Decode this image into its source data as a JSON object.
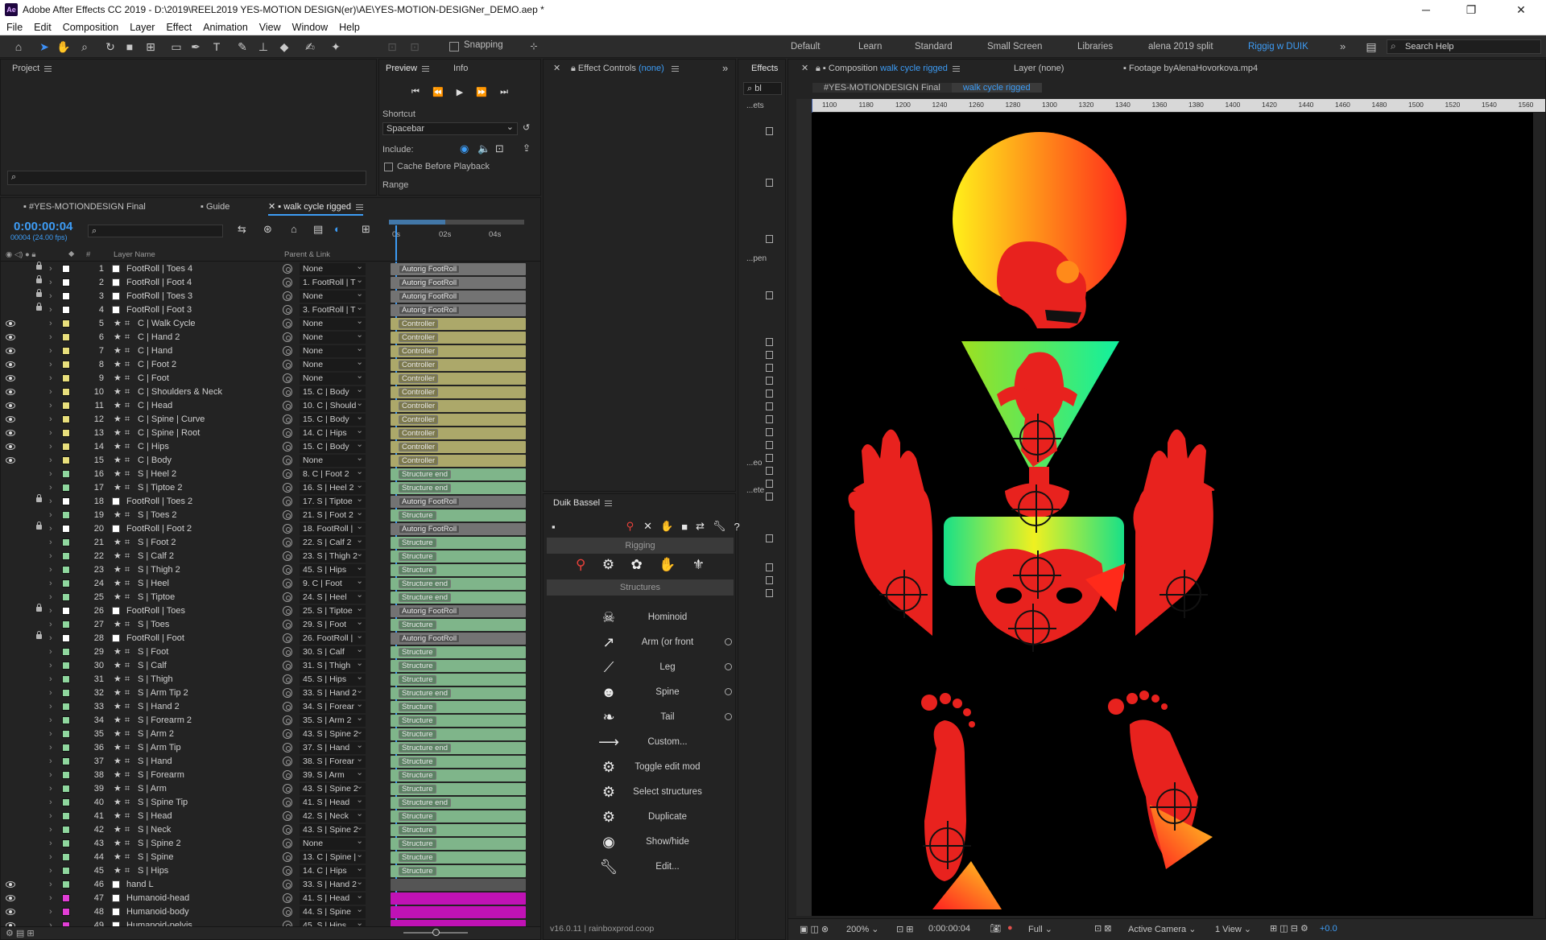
{
  "app": {
    "title": "Adobe After Effects CC 2019 - D:\\2019\\REEL2019 YES-MOTION DESIGN(er)\\AE\\YES-MOTION-DESIGNer_DEMO.aep *",
    "logo": "Ae"
  },
  "menu": [
    "File",
    "Edit",
    "Composition",
    "Layer",
    "Effect",
    "Animation",
    "View",
    "Window",
    "Help"
  ],
  "toolbar": {
    "snapping_label": "Snapping",
    "workspaces": [
      "Default",
      "Learn",
      "Standard",
      "Small Screen",
      "Libraries",
      "alena 2019 split",
      "Riggig w DUIK"
    ],
    "active_workspace": "Riggig w DUIK",
    "search_placeholder": "Search Help"
  },
  "project_panel": {
    "title": "Project"
  },
  "preview_panel": {
    "tabs": [
      "Preview",
      "Info"
    ],
    "shortcut_label": "Shortcut",
    "shortcut_value": "Spacebar",
    "include_label": "Include:",
    "cache_label": "Cache Before Playback",
    "range_label": "Range"
  },
  "effect_controls": {
    "title": "Effect Controls",
    "value": "(none)"
  },
  "effects_panel": {
    "title": "Effects",
    "search_value": "bl",
    "items": [
      "...ets",
      "...pen",
      "...eo",
      "...ete"
    ]
  },
  "timeline": {
    "tabs": [
      "#YES-MOTIONDESIGN Final",
      "Guide",
      "walk cycle rigged"
    ],
    "active_tab": "walk cycle rigged",
    "timecode": "0:00:00:04",
    "frame_info": "00004 (24.00 fps)",
    "col_layer_name": "Layer Name",
    "col_parent": "Parent & Link",
    "ruler": [
      "0s",
      "02s",
      "04s"
    ],
    "layers": [
      {
        "n": "1",
        "name": "FootRoll | Toes 4",
        "parent": "None",
        "bar": "Autorig FootRoll",
        "eye": false,
        "lock": true,
        "color": "#ffffff",
        "star": false
      },
      {
        "n": "2",
        "name": "FootRoll | Foot 4",
        "parent": "1. FootRoll | T",
        "bar": "Autorig FootRoll",
        "eye": false,
        "lock": true,
        "color": "#ffffff",
        "star": false
      },
      {
        "n": "3",
        "name": "FootRoll | Toes 3",
        "parent": "None",
        "bar": "Autorig FootRoll",
        "eye": false,
        "lock": true,
        "color": "#ffffff",
        "star": false
      },
      {
        "n": "4",
        "name": "FootRoll | Foot 3",
        "parent": "3. FootRoll | T",
        "bar": "Autorig FootRoll",
        "eye": false,
        "lock": true,
        "color": "#ffffff",
        "star": false
      },
      {
        "n": "5",
        "name": "C | Walk Cycle",
        "parent": "None",
        "bar": "Controller",
        "eye": true,
        "lock": false,
        "color": "#e8df7c",
        "star": true
      },
      {
        "n": "6",
        "name": "C | Hand 2",
        "parent": "None",
        "bar": "Controller",
        "eye": true,
        "lock": false,
        "color": "#e8df7c",
        "star": true
      },
      {
        "n": "7",
        "name": "C | Hand",
        "parent": "None",
        "bar": "Controller",
        "eye": true,
        "lock": false,
        "color": "#e8df7c",
        "star": true
      },
      {
        "n": "8",
        "name": "C | Foot 2",
        "parent": "None",
        "bar": "Controller",
        "eye": true,
        "lock": false,
        "color": "#e8df7c",
        "star": true
      },
      {
        "n": "9",
        "name": "C | Foot",
        "parent": "None",
        "bar": "Controller",
        "eye": true,
        "lock": false,
        "color": "#e8df7c",
        "star": true
      },
      {
        "n": "10",
        "name": "C | Shoulders & Neck",
        "parent": "15. C | Body",
        "bar": "Controller",
        "eye": true,
        "lock": false,
        "color": "#e8df7c",
        "star": true
      },
      {
        "n": "11",
        "name": "C | Head",
        "parent": "10. C | Should",
        "bar": "Controller",
        "eye": true,
        "lock": false,
        "color": "#e8df7c",
        "star": true
      },
      {
        "n": "12",
        "name": "C | Spine | Curve",
        "parent": "15. C | Body",
        "bar": "Controller",
        "eye": true,
        "lock": false,
        "color": "#e8df7c",
        "star": true
      },
      {
        "n": "13",
        "name": "C | Spine | Root",
        "parent": "14. C | Hips",
        "bar": "Controller",
        "eye": true,
        "lock": false,
        "color": "#e8df7c",
        "star": true
      },
      {
        "n": "14",
        "name": "C | Hips",
        "parent": "15. C | Body",
        "bar": "Controller",
        "eye": true,
        "lock": false,
        "color": "#e8df7c",
        "star": true
      },
      {
        "n": "15",
        "name": "C | Body",
        "parent": "None",
        "bar": "Controller",
        "eye": true,
        "lock": false,
        "color": "#e8df7c",
        "star": true
      },
      {
        "n": "16",
        "name": "S | Heel 2",
        "parent": "8. C | Foot 2",
        "bar": "Structure end",
        "eye": false,
        "lock": false,
        "color": "#8fd79e",
        "star": true
      },
      {
        "n": "17",
        "name": "S | Tiptoe 2",
        "parent": "16. S | Heel 2",
        "bar": "Structure end",
        "eye": false,
        "lock": false,
        "color": "#8fd79e",
        "star": true
      },
      {
        "n": "18",
        "name": "FootRoll | Toes 2",
        "parent": "17. S | Tiptoe",
        "bar": "Autorig FootRoll",
        "eye": false,
        "lock": true,
        "color": "#ffffff",
        "star": false
      },
      {
        "n": "19",
        "name": "S | Toes 2",
        "parent": "21. S | Foot 2",
        "bar": "Structure",
        "eye": false,
        "lock": false,
        "color": "#8fd79e",
        "star": true
      },
      {
        "n": "20",
        "name": "FootRoll | Foot 2",
        "parent": "18. FootRoll |",
        "bar": "Autorig FootRoll",
        "eye": false,
        "lock": true,
        "color": "#ffffff",
        "star": false
      },
      {
        "n": "21",
        "name": "S | Foot 2",
        "parent": "22. S | Calf 2",
        "bar": "Structure",
        "eye": false,
        "lock": false,
        "color": "#8fd79e",
        "star": true
      },
      {
        "n": "22",
        "name": "S | Calf 2",
        "parent": "23. S | Thigh 2",
        "bar": "Structure",
        "eye": false,
        "lock": false,
        "color": "#8fd79e",
        "star": true
      },
      {
        "n": "23",
        "name": "S | Thigh 2",
        "parent": "45. S | Hips",
        "bar": "Structure",
        "eye": false,
        "lock": false,
        "color": "#8fd79e",
        "star": true
      },
      {
        "n": "24",
        "name": "S | Heel",
        "parent": "9. C | Foot",
        "bar": "Structure end",
        "eye": false,
        "lock": false,
        "color": "#8fd79e",
        "star": true
      },
      {
        "n": "25",
        "name": "S | Tiptoe",
        "parent": "24. S | Heel",
        "bar": "Structure end",
        "eye": false,
        "lock": false,
        "color": "#8fd79e",
        "star": true
      },
      {
        "n": "26",
        "name": "FootRoll | Toes",
        "parent": "25. S | Tiptoe",
        "bar": "Autorig FootRoll",
        "eye": false,
        "lock": true,
        "color": "#ffffff",
        "star": false
      },
      {
        "n": "27",
        "name": "S | Toes",
        "parent": "29. S | Foot",
        "bar": "Structure",
        "eye": false,
        "lock": false,
        "color": "#8fd79e",
        "star": true
      },
      {
        "n": "28",
        "name": "FootRoll | Foot",
        "parent": "26. FootRoll |",
        "bar": "Autorig FootRoll",
        "eye": false,
        "lock": true,
        "color": "#ffffff",
        "star": false
      },
      {
        "n": "29",
        "name": "S | Foot",
        "parent": "30. S | Calf",
        "bar": "Structure",
        "eye": false,
        "lock": false,
        "color": "#8fd79e",
        "star": true
      },
      {
        "n": "30",
        "name": "S | Calf",
        "parent": "31. S | Thigh",
        "bar": "Structure",
        "eye": false,
        "lock": false,
        "color": "#8fd79e",
        "star": true
      },
      {
        "n": "31",
        "name": "S | Thigh",
        "parent": "45. S | Hips",
        "bar": "Structure",
        "eye": false,
        "lock": false,
        "color": "#8fd79e",
        "star": true
      },
      {
        "n": "32",
        "name": "S | Arm Tip 2",
        "parent": "33. S | Hand 2",
        "bar": "Structure end",
        "eye": false,
        "lock": false,
        "color": "#8fd79e",
        "star": true
      },
      {
        "n": "33",
        "name": "S | Hand 2",
        "parent": "34. S | Forear",
        "bar": "Structure",
        "eye": false,
        "lock": false,
        "color": "#8fd79e",
        "star": true
      },
      {
        "n": "34",
        "name": "S | Forearm 2",
        "parent": "35. S | Arm 2",
        "bar": "Structure",
        "eye": false,
        "lock": false,
        "color": "#8fd79e",
        "star": true
      },
      {
        "n": "35",
        "name": "S | Arm 2",
        "parent": "43. S | Spine 2",
        "bar": "Structure",
        "eye": false,
        "lock": false,
        "color": "#8fd79e",
        "star": true
      },
      {
        "n": "36",
        "name": "S | Arm Tip",
        "parent": "37. S | Hand",
        "bar": "Structure end",
        "eye": false,
        "lock": false,
        "color": "#8fd79e",
        "star": true
      },
      {
        "n": "37",
        "name": "S | Hand",
        "parent": "38. S | Forear",
        "bar": "Structure",
        "eye": false,
        "lock": false,
        "color": "#8fd79e",
        "star": true
      },
      {
        "n": "38",
        "name": "S | Forearm",
        "parent": "39. S | Arm",
        "bar": "Structure",
        "eye": false,
        "lock": false,
        "color": "#8fd79e",
        "star": true
      },
      {
        "n": "39",
        "name": "S | Arm",
        "parent": "43. S | Spine 2",
        "bar": "Structure",
        "eye": false,
        "lock": false,
        "color": "#8fd79e",
        "star": true
      },
      {
        "n": "40",
        "name": "S | Spine Tip",
        "parent": "41. S | Head",
        "bar": "Structure end",
        "eye": false,
        "lock": false,
        "color": "#8fd79e",
        "star": true
      },
      {
        "n": "41",
        "name": "S | Head",
        "parent": "42. S | Neck",
        "bar": "Structure",
        "eye": false,
        "lock": false,
        "color": "#8fd79e",
        "star": true
      },
      {
        "n": "42",
        "name": "S | Neck",
        "parent": "43. S | Spine 2",
        "bar": "Structure",
        "eye": false,
        "lock": false,
        "color": "#8fd79e",
        "star": true
      },
      {
        "n": "43",
        "name": "S | Spine 2",
        "parent": "None",
        "bar": "Structure",
        "eye": false,
        "lock": false,
        "color": "#8fd79e",
        "star": true
      },
      {
        "n": "44",
        "name": "S | Spine",
        "parent": "13. C | Spine |",
        "bar": "Structure",
        "eye": false,
        "lock": false,
        "color": "#8fd79e",
        "star": true
      },
      {
        "n": "45",
        "name": "S | Hips",
        "parent": "14. C | Hips",
        "bar": "Structure",
        "eye": false,
        "lock": false,
        "color": "#8fd79e",
        "star": true
      },
      {
        "n": "46",
        "name": "hand L",
        "parent": "33. S | Hand 2",
        "bar": "",
        "eye": true,
        "lock": false,
        "color": "#8fd79e",
        "star": false
      },
      {
        "n": "47",
        "name": "Humanoid-head",
        "parent": "41. S | Head",
        "bar": "",
        "eye": true,
        "lock": false,
        "color": "#e23ed6",
        "star": false
      },
      {
        "n": "48",
        "name": "Humanoid-body",
        "parent": "44. S | Spine",
        "bar": "",
        "eye": true,
        "lock": false,
        "color": "#e23ed6",
        "star": false
      },
      {
        "n": "49",
        "name": "Humanoid-pelvis",
        "parent": "45. S | Hips",
        "bar": "",
        "eye": true,
        "lock": false,
        "color": "#e23ed6",
        "star": false
      }
    ]
  },
  "duik": {
    "title": "Duik Bassel",
    "section_rigging": "Rigging",
    "section_structures": "Structures",
    "items": [
      "Hominoid",
      "Arm (or front",
      "Leg",
      "Spine",
      "Tail",
      "Custom...",
      "Toggle edit mod",
      "Select structures",
      "Duplicate",
      "Show/hide",
      "Edit..."
    ],
    "version": "v16.0.11 | rainboxprod.coop"
  },
  "composition": {
    "tab_label": "Composition",
    "tab_value": "walk cycle rigged",
    "layer_tab": "Layer (none)",
    "footage_tab": "Footage byAlenaHovorkova.mp4",
    "breadcrumbs": [
      "#YES-MOTIONDESIGN Final",
      "walk cycle rigged"
    ],
    "ruler": [
      "1100",
      "1180",
      "1200",
      "1240",
      "1260",
      "1280",
      "1300",
      "1320",
      "1340",
      "1360",
      "1380",
      "1400",
      "1420",
      "1440",
      "1460",
      "1480",
      "1500",
      "1520",
      "1540",
      "1560"
    ],
    "zoom": "200%",
    "timecode": "0:00:00:04",
    "resolution": "Full",
    "camera": "Active Camera",
    "views": "1 View",
    "exposure": "+0.0"
  },
  "colors": {
    "accent": "#3d9cf5",
    "controller": "#aca86a",
    "structure": "#7fb58a",
    "autorig": "#737373",
    "humanoid": "#c012b5",
    "figure_red": "#e8221e"
  }
}
